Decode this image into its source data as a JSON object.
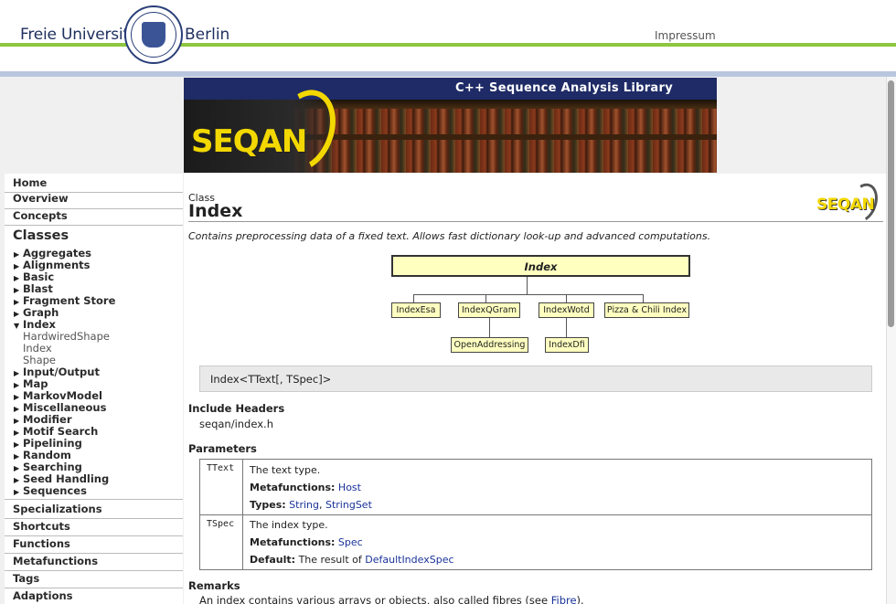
{
  "header": {
    "uni_left": "Freie Universität",
    "uni_right": "Berlin",
    "impressum": "Impressum"
  },
  "banner": {
    "title": "C++ Sequence Analysis Library",
    "logo": "SEQAN"
  },
  "sidebar": {
    "home": "Home",
    "overview": "Overview",
    "concepts": "Concepts",
    "classes_heading": "Classes",
    "classes": [
      "Aggregates",
      "Alignments",
      "Basic",
      "Blast",
      "Fragment Store",
      "Graph",
      "Index"
    ],
    "index_children": [
      "HardwiredShape",
      "Index",
      "Shape"
    ],
    "classes_after": [
      "Input/Output",
      "Map",
      "MarkovModel",
      "Miscellaneous",
      "Modifier",
      "Motif Search",
      "Pipelining",
      "Random",
      "Searching",
      "Seed Handling",
      "Sequences"
    ],
    "bottom": [
      "Specializations",
      "Shortcuts",
      "Functions",
      "Metafunctions",
      "Tags",
      "Adaptions"
    ]
  },
  "page": {
    "kind": "Class",
    "title": "Index",
    "mini_logo": "SEQAN",
    "summary": "Contains preprocessing data of a fixed text. Allows fast dictionary look-up and advanced computations.",
    "diagram": {
      "root": "Index",
      "children": [
        "IndexEsa",
        "IndexQGram",
        "IndexWotd",
        "Pizza & Chili Index"
      ],
      "grandchildren": [
        "OpenAddressing",
        "IndexDfi"
      ]
    },
    "signature": "Index<TText[, TSpec]>",
    "include_heading": "Include Headers",
    "include_value": "seqan/index.h",
    "params_heading": "Parameters",
    "params": [
      {
        "name": "TText",
        "desc": "The text type.",
        "metafunctions_label": "Metafunctions:",
        "metafunctions_link": "Host",
        "extra_label": "Types:",
        "extra_links": [
          "String",
          "StringSet"
        ],
        "extra_sep": ", "
      },
      {
        "name": "TSpec",
        "desc": "The index type.",
        "metafunctions_label": "Metafunctions:",
        "metafunctions_link": "Spec",
        "extra_label": "Default:",
        "extra_text": "The result of",
        "extra_link": "DefaultIndexSpec"
      }
    ],
    "remarks_heading": "Remarks",
    "remarks_text": "An index contains various arrays or objects, also called fibres (see",
    "remarks_link": "Fibre",
    "remarks_end": ")."
  },
  "colors": {
    "banner_blue": "#1f2b66",
    "fu_green": "#8dc63f",
    "node_fill": "#ffffc0",
    "link": "#1a3399",
    "logo_yellow": "#f3d800"
  }
}
